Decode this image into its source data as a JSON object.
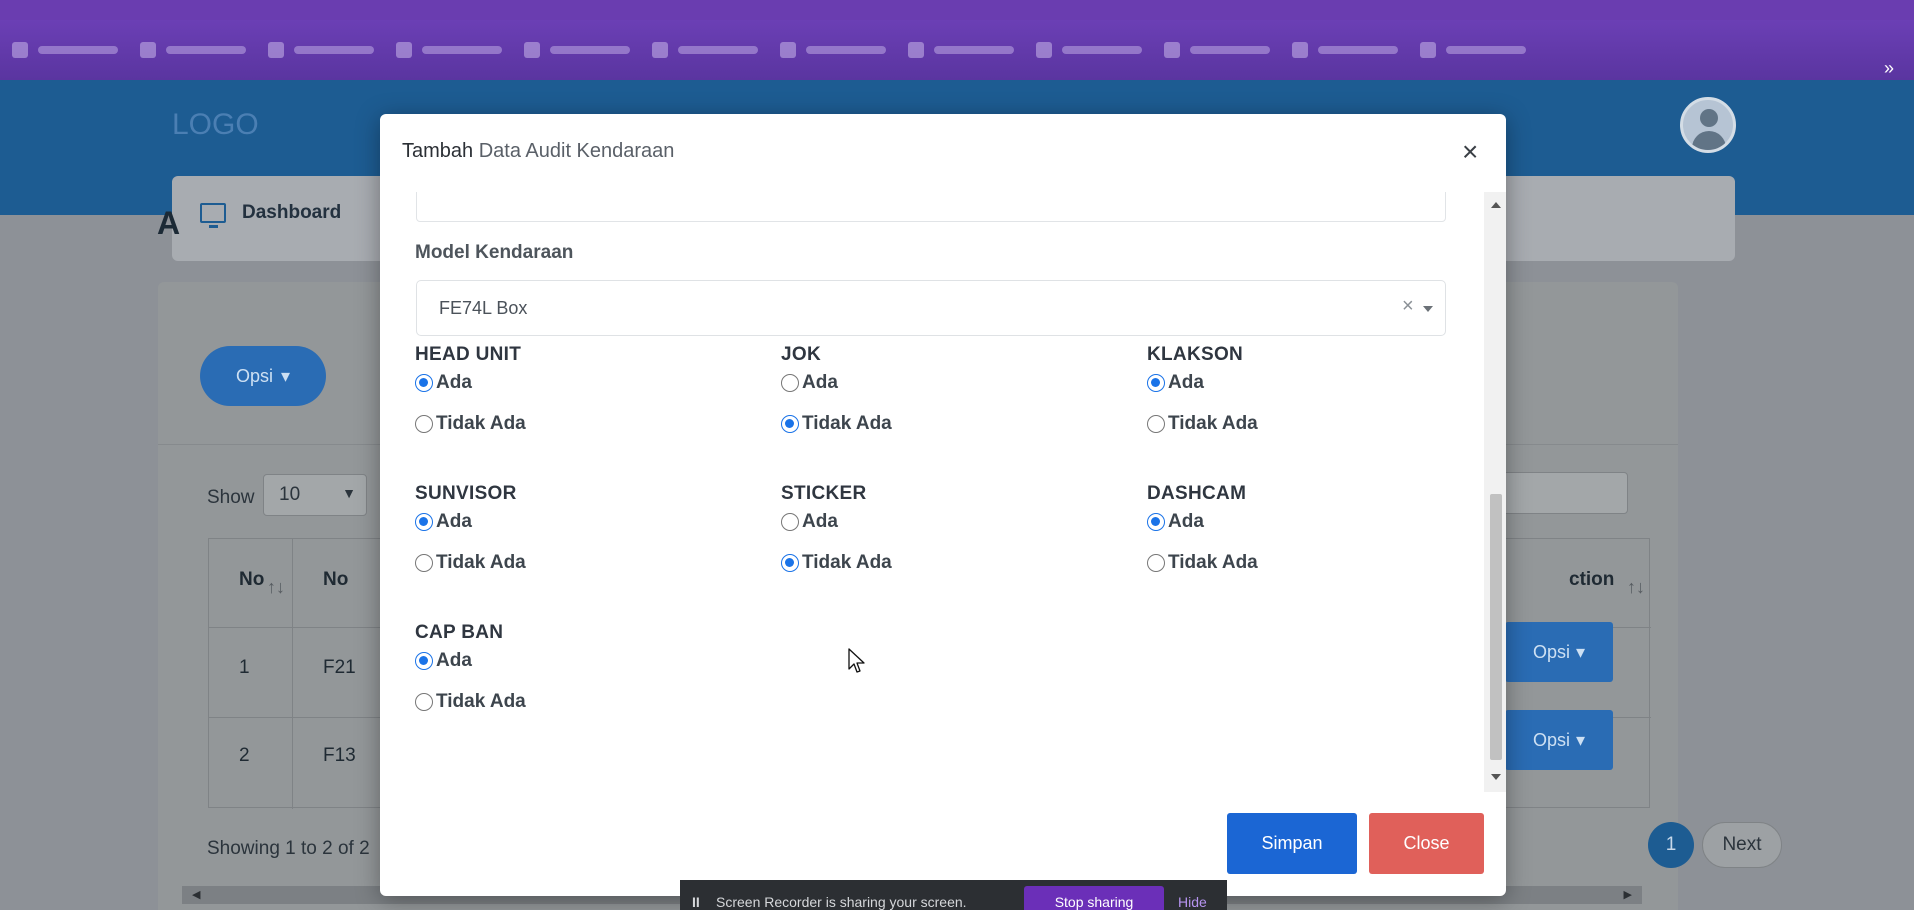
{
  "background": {
    "logo_alt": "LOGO",
    "nav": {
      "dashboard": "Dashboard"
    },
    "page_letter": "A",
    "opsi_button": "Opsi",
    "show_label": "Show",
    "show_value": "10",
    "table": {
      "headers": [
        "No",
        "No",
        "ction"
      ],
      "rows": [
        {
          "no": "1",
          "code": "F21",
          "action": "Opsi"
        },
        {
          "no": "2",
          "code": "F13",
          "action": "Opsi"
        }
      ]
    },
    "showing_text": "Showing 1 to 2 of 2",
    "pagination": {
      "active": "1",
      "next": "Next"
    }
  },
  "modal": {
    "title_bold": "Tambah",
    "title_rest": "Data Audit Kendaraan",
    "close_icon": "×",
    "model_label": "Model Kendaraan",
    "model_value": "FE74L Box",
    "model_clear": "×",
    "option_ada": "Ada",
    "option_tidak_ada": "Tidak Ada",
    "fields": [
      {
        "label": "HEAD UNIT",
        "selected": "Ada"
      },
      {
        "label": "JOK",
        "selected": "Tidak Ada"
      },
      {
        "label": "KLAKSON",
        "selected": "Ada"
      },
      {
        "label": "SUNVISOR",
        "selected": "Ada"
      },
      {
        "label": "STICKER",
        "selected": "Tidak Ada"
      },
      {
        "label": "DASHCAM",
        "selected": "Ada"
      },
      {
        "label": "CAP BAN",
        "selected": "Ada"
      }
    ],
    "simpan": "Simpan",
    "close": "Close"
  },
  "colors": {
    "primary": "#1b66d4",
    "danger": "#e0605a",
    "radio_checked": "#1a73e8",
    "header_blue": "#1d5c92"
  },
  "share_bar": {
    "message": "Screen Recorder is sharing your screen.",
    "stop": "Stop sharing",
    "hide": "Hide"
  }
}
